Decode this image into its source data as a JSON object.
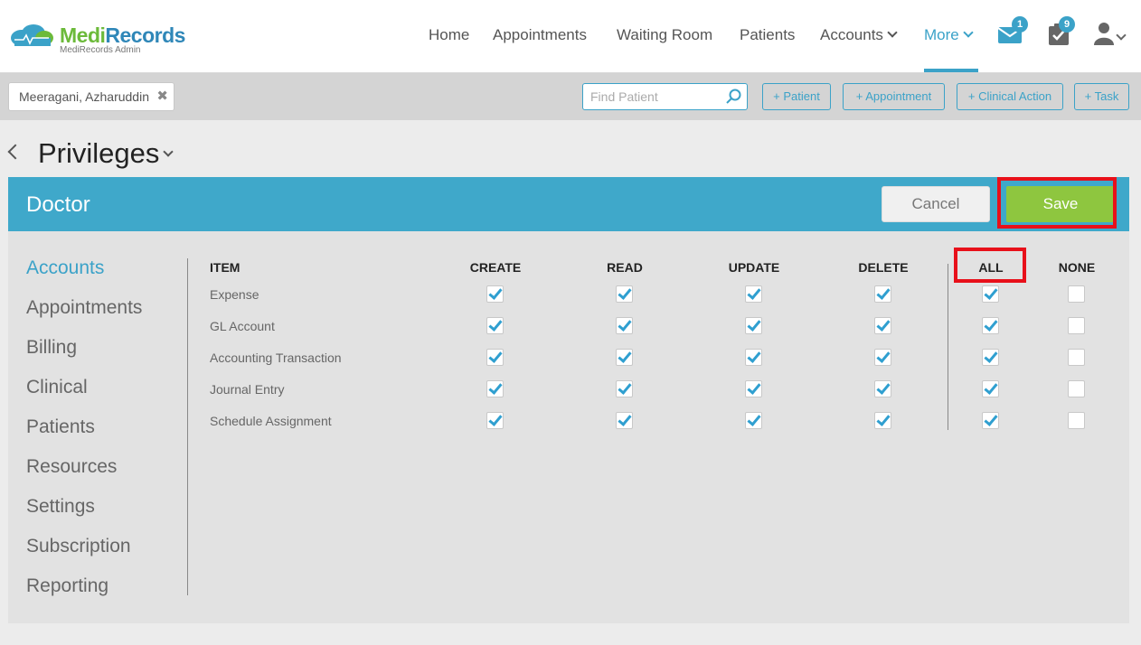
{
  "brand": {
    "name_part1": "Medi",
    "name_part2": "Records",
    "subtitle": "MediRecords Admin"
  },
  "nav": {
    "items": [
      {
        "label": "Home"
      },
      {
        "label": "Appointments"
      },
      {
        "label": "Waiting Room"
      },
      {
        "label": "Patients"
      },
      {
        "label": "Accounts"
      },
      {
        "label": "More"
      }
    ],
    "active": "More",
    "mail_badge": "1",
    "tasks_badge": "9"
  },
  "subbar": {
    "patient_chip": "Meeragani, Azharuddin",
    "find_placeholder": "Find Patient",
    "buttons": [
      "+ Patient",
      "+ Appointment",
      "+ Clinical Action",
      "+ Task"
    ]
  },
  "page": {
    "title": "Privileges"
  },
  "role": {
    "name": "Doctor",
    "cancel_label": "Cancel",
    "save_label": "Save"
  },
  "sidebar": {
    "items": [
      "Accounts",
      "Appointments",
      "Billing",
      "Clinical",
      "Patients",
      "Resources",
      "Settings",
      "Subscription",
      "Reporting"
    ],
    "active": "Accounts"
  },
  "table": {
    "headers": [
      "ITEM",
      "CREATE",
      "READ",
      "UPDATE",
      "DELETE",
      "ALL",
      "NONE"
    ],
    "rows": [
      {
        "item": "Expense",
        "create": true,
        "read": true,
        "update": true,
        "delete": true,
        "all": true,
        "none": false
      },
      {
        "item": "GL Account",
        "create": true,
        "read": true,
        "update": true,
        "delete": true,
        "all": true,
        "none": false
      },
      {
        "item": "Accounting Transaction",
        "create": true,
        "read": true,
        "update": true,
        "delete": true,
        "all": true,
        "none": false
      },
      {
        "item": "Journal Entry",
        "create": true,
        "read": true,
        "update": true,
        "delete": true,
        "all": true,
        "none": false
      },
      {
        "item": "Schedule Assignment",
        "create": true,
        "read": true,
        "update": true,
        "delete": true,
        "all": true,
        "none": false
      }
    ]
  },
  "colors": {
    "accent": "#3ba2c8",
    "save": "#8ec63f",
    "highlight": "#e8101a"
  }
}
